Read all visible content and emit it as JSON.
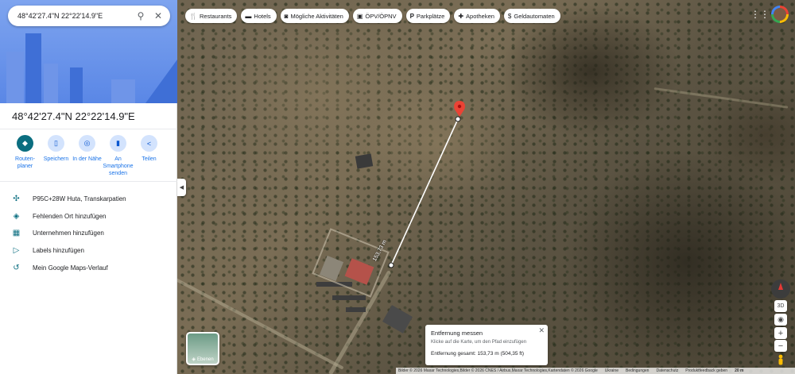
{
  "search": {
    "value": "48°42'27.4\"N 22°22'14.9\"E"
  },
  "place": {
    "title": "48°42'27.4\"N 22°22'14.9\"E"
  },
  "actions": [
    {
      "label": "Routen-planer",
      "icon": "directions-icon"
    },
    {
      "label": "Speichern",
      "icon": "bookmark-icon"
    },
    {
      "label": "In der Nähe",
      "icon": "nearby-icon"
    },
    {
      "label": "An Smartphone senden",
      "icon": "phone-icon"
    },
    {
      "label": "Teilen",
      "icon": "share-icon"
    }
  ],
  "info_items": [
    {
      "text": "P95C+28W Huta, Transkarpatien",
      "icon": "plus-code-icon"
    },
    {
      "text": "Fehlenden Ort hinzufügen",
      "icon": "add-place-icon"
    },
    {
      "text": "Unternehmen hinzufügen",
      "icon": "add-business-icon"
    },
    {
      "text": "Labels hinzufügen",
      "icon": "label-icon"
    },
    {
      "text": "Mein Google Maps-Verlauf",
      "icon": "history-icon"
    }
  ],
  "chips": [
    {
      "label": "Restaurants",
      "icon": "restaurant-icon"
    },
    {
      "label": "Hotels",
      "icon": "hotel-icon"
    },
    {
      "label": "Mögliche Aktivitäten",
      "icon": "camera-icon"
    },
    {
      "label": "ÖPV/ÖPNV",
      "icon": "transit-icon"
    },
    {
      "label": "Parkplätze",
      "icon": "parking-icon"
    },
    {
      "label": "Apotheken",
      "icon": "pharmacy-icon"
    },
    {
      "label": "Geldautomaten",
      "icon": "atm-icon"
    }
  ],
  "measure": {
    "distance_label": "153,73 m",
    "dialog_title": "Entfernung messen",
    "dialog_hint": "Klicke auf die Karte, um den Pfad einzufügen",
    "dialog_total": "Entfernung gesamt: 153,73 m (504,35 ft)"
  },
  "layers": {
    "label": "Ebenen"
  },
  "controls": {
    "tilt": "3D"
  },
  "footer": {
    "attribution": "Bilder © 2026 Maxar Technologies,Bilder © 2026 CNES / Airbus,Maxar Technologies,Kartendaten © 2026 Google",
    "links": [
      "Ukraine",
      "Bedingungen",
      "Datenschutz",
      "Produktfeedback geben"
    ],
    "scale": "20 m"
  },
  "colors": {
    "accent": "#0b6e80",
    "pin": "#ea4335",
    "link": "#1a73e8"
  }
}
